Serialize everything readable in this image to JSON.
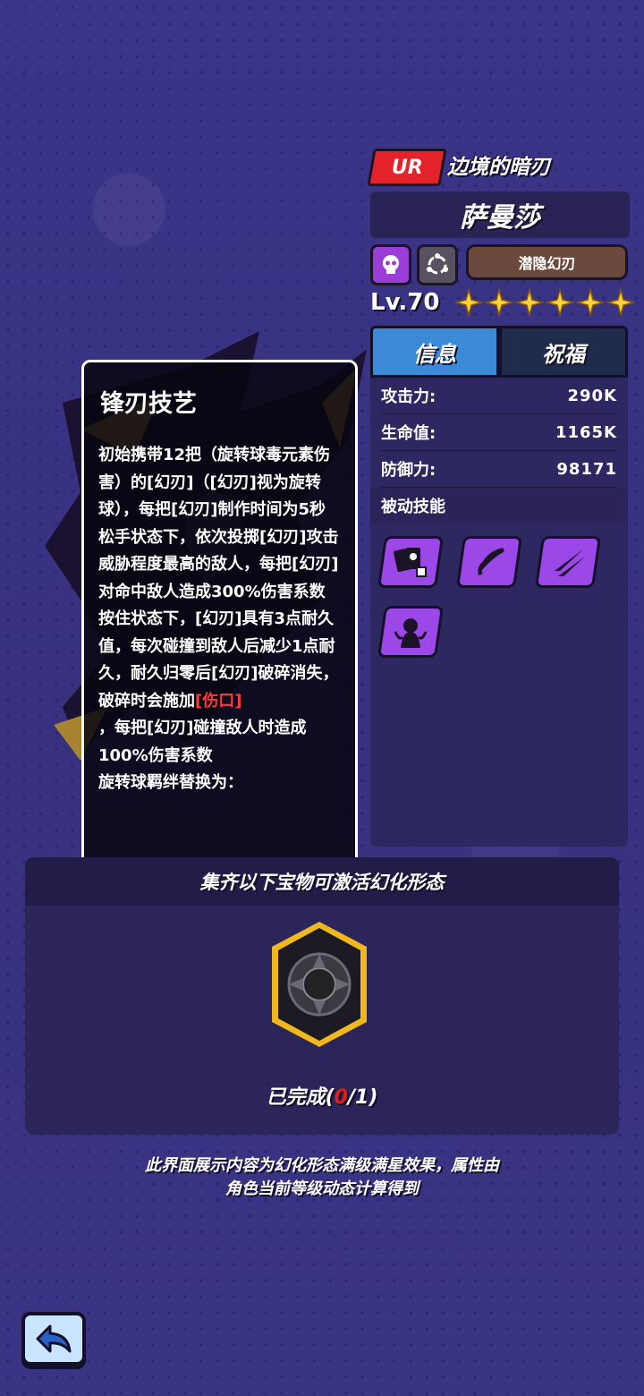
{
  "header": {
    "rarity": "UR",
    "title": "边境的暗刃",
    "name": "萨曼莎",
    "type_icons": [
      "skull-icon",
      "orbit-icon"
    ],
    "form_button": "潜隐幻刃",
    "level": "Lv.70",
    "stars": 6
  },
  "tabs": [
    {
      "label": "信息",
      "active": true
    },
    {
      "label": "祝福",
      "active": false
    }
  ],
  "stats": [
    {
      "label": "攻击力:",
      "value": "290K"
    },
    {
      "label": "生命值:",
      "value": "1165K"
    },
    {
      "label": "防御力:",
      "value": "98171"
    }
  ],
  "passive": {
    "label": "被动技能",
    "skills": [
      "cards-skull-skill-icon",
      "blade-slash-skill-icon",
      "claw-slash-skill-icon",
      "shadow-figure-skill-icon"
    ]
  },
  "tooltip": {
    "title": "锋刃技艺",
    "body_before": "初始携带12把（旋转球毒元素伤害）的[幻刃]（[幻刃]视为旋转球），每把[幻刃]制作时间为5秒\n松手状态下，依次投掷[幻刃]攻击威胁程度最高的敌人，每把[幻刃]对命中敌人造成300%伤害系数\n按住状态下，[幻刃]具有3点耐久值，每次碰撞到敌人后减少1点耐久，耐久归零后[幻刃]破碎消失，破碎时会施加",
    "highlight": "[伤口]",
    "body_after": "\n，每把[幻刃]碰撞敌人时造成100%伤害系数\n旋转球羁绊替换为：",
    "highlight_color": "#ff3a3a"
  },
  "collection": {
    "header": "集齐以下宝物可激活幻化形态",
    "treasure_icon": "dark-wheel-treasure-icon",
    "progress_prefix": "已完成(",
    "progress_current": "0",
    "progress_suffix": "/1)"
  },
  "note": {
    "line1": "此界面展示内容为幻化形态满级满星效果，属性由",
    "line2": "角色当前等级动态计算得到"
  },
  "colors": {
    "background": "#3a3484",
    "rarity": "#e3222a",
    "tab_active": "#3a8ad8",
    "skill_icon": "#9c48e8",
    "star": "#ffd23a"
  }
}
